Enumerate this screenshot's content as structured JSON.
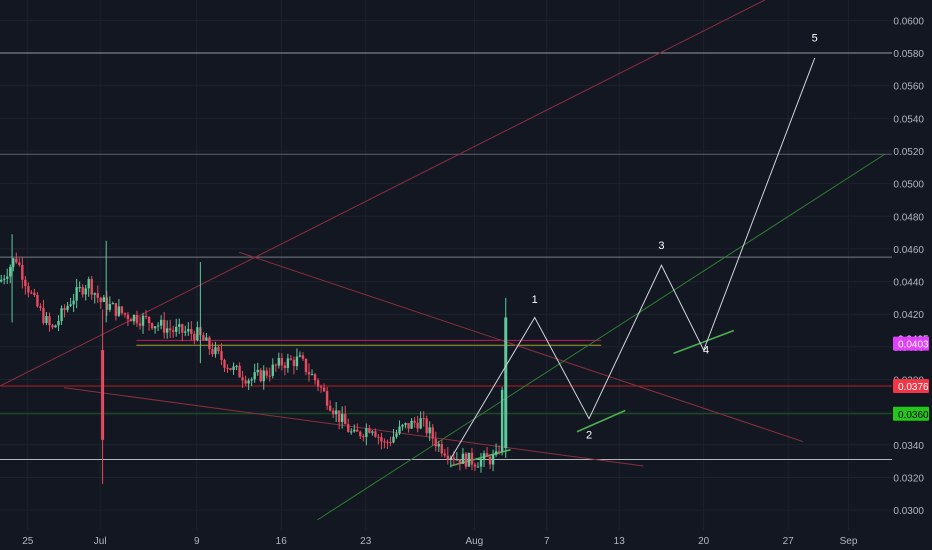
{
  "colors": {
    "background": "#131722",
    "up": "#26a69a",
    "down": "#ef5350",
    "up_candle": "#5ec99a",
    "down_candle": "#e84a5f",
    "grid": "#1e222d",
    "axis_text": "#b2b5be",
    "wave_line": "#d1d4dc",
    "green_line": "#4caf50",
    "red_line": "#a03a4a",
    "pink_label": "#e040fb",
    "red_label": "#f23645",
    "green_label": "#22c719"
  },
  "chart_data": {
    "type": "candlestick",
    "x_axis": {
      "ticks": [
        {
          "label": "25",
          "day": -6
        },
        {
          "label": "Jul",
          "day": 0
        },
        {
          "label": "9",
          "day": 8
        },
        {
          "label": "16",
          "day": 15
        },
        {
          "label": "23",
          "day": 22
        },
        {
          "label": "Aug",
          "day": 31
        },
        {
          "label": "7",
          "day": 37
        },
        {
          "label": "13",
          "day": 43
        },
        {
          "label": "20",
          "day": 50
        },
        {
          "label": "27",
          "day": 57
        },
        {
          "label": "Sep",
          "day": 62
        }
      ],
      "range": [
        -8.3,
        65.6
      ]
    },
    "y_axis": {
      "ticks": [
        "0.0600",
        "0.0580",
        "0.0560",
        "0.0540",
        "0.0520",
        "0.0500",
        "0.0480",
        "0.0460",
        "0.0440",
        "0.0420",
        "0.0400",
        "0.0380",
        "0.0360",
        "0.0340",
        "0.0320",
        "0.0300"
      ],
      "range": [
        0.02878,
        0.06125
      ]
    },
    "price_labels": [
      {
        "text": "0.0405",
        "value": 0.0405,
        "bg": "#131722",
        "fg": "#ffffff"
      },
      {
        "text": "0.0403",
        "value": 0.0402,
        "bg": "#e040fb",
        "fg": "#ffffff"
      },
      {
        "text": "0.0376",
        "value": 0.0376,
        "bg": "#f23645",
        "fg": "#ffffff"
      },
      {
        "text": "0.0360",
        "value": 0.0359,
        "bg": "#22c719",
        "fg": "#000000"
      }
    ],
    "horizontal_levels": [
      {
        "value": 0.058,
        "color": "#9598a1",
        "from_day": -8.3
      },
      {
        "value": 0.0518,
        "color": "#5d606b",
        "from_day": -8.3
      },
      {
        "value": 0.0455,
        "color": "#787b86",
        "from_day": -8.3
      },
      {
        "value": 0.0404,
        "color": "#c2185b",
        "from_day": 3
      },
      {
        "value": 0.0401,
        "color": "#9e9d24",
        "from_day": 3
      },
      {
        "value": 0.0376,
        "color": "#b71c1c",
        "from_day": -8.3
      },
      {
        "value": 0.0359,
        "color": "#1b5e20",
        "from_day": -8.3
      },
      {
        "value": 0.0331,
        "color": "#b2b5be",
        "from_day": -8.3
      }
    ],
    "trend_lines": [
      {
        "points": [
          [
            -8.3,
            0.0376
          ],
          [
            56,
            0.0616
          ]
        ],
        "color": "#8a2f3f"
      },
      {
        "points": [
          [
            11.5,
            0.0458
          ],
          [
            58.2,
            0.0342
          ]
        ],
        "color": "#8a2f3f"
      },
      {
        "points": [
          [
            -3,
            0.0375
          ],
          [
            45,
            0.0327
          ]
        ],
        "color": "#8a2f3f"
      },
      {
        "points": [
          [
            18,
            0.0294
          ],
          [
            65,
            0.0518
          ]
        ],
        "color": "#2e7d32"
      }
    ],
    "green_segments": [
      [
        [
          29,
          0.0327
        ],
        [
          34,
          0.0337
        ]
      ],
      [
        [
          39.5,
          0.0348
        ],
        [
          43.5,
          0.0361
        ]
      ],
      [
        [
          47.5,
          0.0396
        ],
        [
          52.5,
          0.041
        ]
      ]
    ],
    "wave_path": [
      [
        29,
        0.0331
      ],
      [
        36,
        0.0418
      ],
      [
        40.5,
        0.0356
      ],
      [
        46.5,
        0.045
      ],
      [
        50,
        0.0398
      ],
      [
        59.2,
        0.0577
      ]
    ],
    "wave_labels": [
      {
        "text": "1",
        "day": 36,
        "value": 0.0427
      },
      {
        "text": "2",
        "day": 40.5,
        "value": 0.0344
      },
      {
        "text": "3",
        "day": 46.5,
        "value": 0.046
      },
      {
        "text": "4",
        "day": 50.2,
        "value": 0.0396
      },
      {
        "text": "5",
        "day": 59.2,
        "value": 0.0587
      }
    ],
    "candles_end_day": 33.6,
    "candles_anchor": [
      [
        -8.3,
        0.044
      ],
      [
        -7,
        0.0455
      ],
      [
        -5.5,
        0.0428
      ],
      [
        -4,
        0.041
      ],
      [
        -2.5,
        0.0428
      ],
      [
        -1,
        0.044
      ],
      [
        0,
        0.0428
      ],
      [
        2,
        0.042
      ],
      [
        4,
        0.0416
      ],
      [
        6,
        0.041
      ],
      [
        8,
        0.0408
      ],
      [
        9,
        0.04
      ],
      [
        11,
        0.0386
      ],
      [
        12.5,
        0.038
      ],
      [
        14,
        0.0385
      ],
      [
        15,
        0.039
      ],
      [
        16.5,
        0.0392
      ],
      [
        18,
        0.0378
      ],
      [
        19.5,
        0.036
      ],
      [
        21,
        0.0345
      ],
      [
        22.5,
        0.0352
      ],
      [
        23.5,
        0.034
      ],
      [
        25,
        0.035
      ],
      [
        26.5,
        0.0355
      ],
      [
        28,
        0.034
      ],
      [
        29.5,
        0.0332
      ],
      [
        31,
        0.033
      ],
      [
        33,
        0.0332
      ],
      [
        33.6,
        0.041
      ]
    ]
  }
}
